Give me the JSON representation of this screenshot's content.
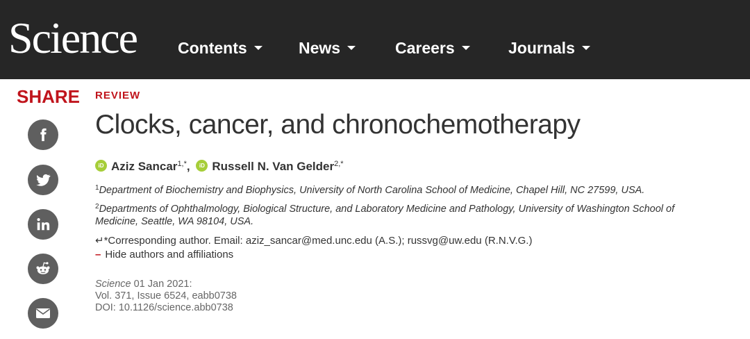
{
  "header": {
    "logo": "Science",
    "nav": [
      {
        "label": "Contents"
      },
      {
        "label": "News"
      },
      {
        "label": "Careers"
      },
      {
        "label": "Journals"
      }
    ]
  },
  "share": {
    "label": "SHARE",
    "buttons": [
      "facebook-icon",
      "twitter-icon",
      "linkedin-icon",
      "reddit-icon",
      "email-icon"
    ]
  },
  "article": {
    "type": "REVIEW",
    "title": "Clocks, cancer, and chronochemotherapy",
    "authors": [
      {
        "name": "Aziz Sancar",
        "sup": "1,*"
      },
      {
        "name": "Russell N. Van Gelder",
        "sup": "2,*"
      }
    ],
    "author_separator": ",",
    "affiliations": [
      {
        "num": "1",
        "text": "Department of Biochemistry and Biophysics, University of North Carolina School of Medicine, Chapel Hill, NC 27599, USA."
      },
      {
        "num": "2",
        "text_line1": "Departments of Ophthalmology, Biological Structure, and Laboratory Medicine and Pathology, University of Washington School of",
        "text_line2": "Medicine, Seattle, WA 98104, USA."
      }
    ],
    "corresponding": {
      "prefix": "↵*Corresponding author. Email: ",
      "email1": "aziz_sancar@med.unc.edu",
      "mid": " (A.S.); ",
      "email2": "russvg@uw.edu",
      "suffix": " (R.N.V.G.)"
    },
    "hide_toggle": {
      "dash": "–",
      "label": "Hide authors and affiliations"
    },
    "citation": {
      "journal": "Science",
      "date": " 01 Jan 2021:",
      "volume": "Vol. 371, Issue 6524, eabb0738",
      "doi": "DOI: 10.1126/science.abb0738"
    }
  },
  "colors": {
    "header_bg": "#262626",
    "accent_red": "#c0141c",
    "orcid_green": "#a6ce39",
    "share_button_gray": "#5f5f5f"
  }
}
